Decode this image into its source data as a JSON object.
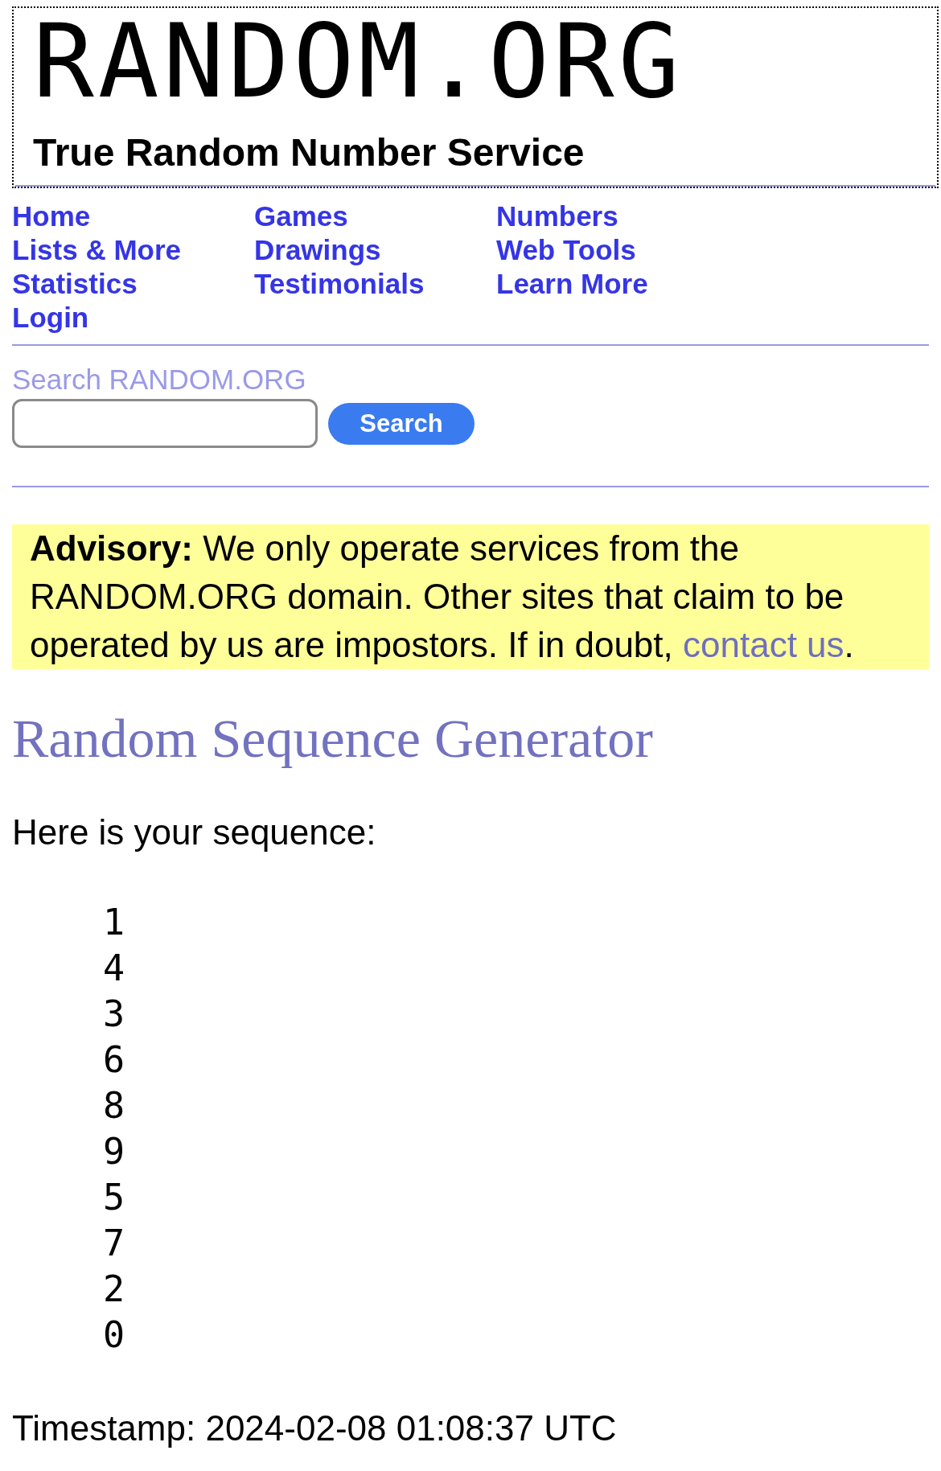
{
  "header": {
    "logo": "RANDOM.ORG",
    "tagline": "True Random Number Service"
  },
  "nav": {
    "columns": [
      {
        "items": [
          "Home",
          "Lists & More",
          "Statistics",
          "Login"
        ]
      },
      {
        "items": [
          "Games",
          "Drawings",
          "Testimonials"
        ]
      },
      {
        "items": [
          "Numbers",
          "Web Tools",
          "Learn More"
        ]
      }
    ]
  },
  "search": {
    "label": "Search RANDOM.ORG",
    "button": "Search"
  },
  "advisory": {
    "text": "**Advisory:** We only operate services from the RANDOM.ORG domain. Other sites that claim to be operated by us are impostors. If in doubt, ",
    "link": "contact us",
    "end": "."
  },
  "heading": "Random Sequence Generator",
  "intro": "Here is your sequence:",
  "sequence": [
    "1",
    "4",
    "3",
    "6",
    "8",
    "9",
    "5",
    "7",
    "2",
    "0"
  ],
  "timestamp": "Timestamp: 2024-02-08 01:08:37 UTC"
}
